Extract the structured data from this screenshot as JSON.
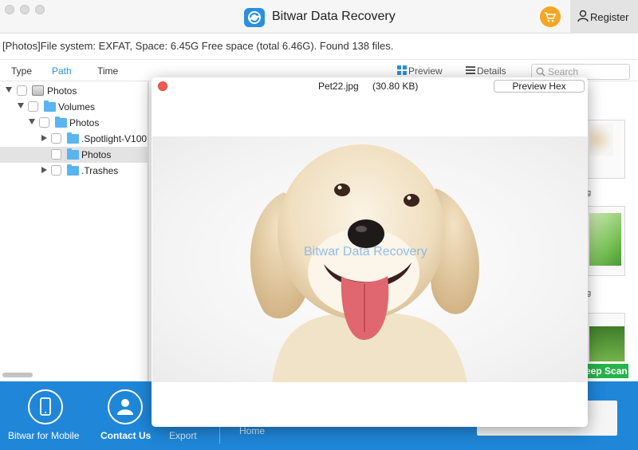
{
  "app": {
    "title": "Bitwar Data Recovery",
    "register_label": "Register"
  },
  "info": {
    "text": "[Photos]File system: EXFAT, Space: 6.45G Free space (total 6.46G). Found 138 files."
  },
  "toolbar": {
    "tabs": [
      {
        "label": "Type",
        "active": false
      },
      {
        "label": "Path",
        "active": true
      },
      {
        "label": "Time",
        "active": false
      }
    ],
    "preview_label": "Preview",
    "details_label": "Details",
    "search_placeholder": "Search"
  },
  "tree": {
    "items": [
      {
        "label": "Photos",
        "level": 0,
        "expander": "down",
        "icon": "drive-icon",
        "selected": false
      },
      {
        "label": "Volumes",
        "level": 1,
        "expander": "down",
        "icon": "folder-icon",
        "selected": false
      },
      {
        "label": "Photos",
        "level": 2,
        "expander": "down",
        "icon": "folder-icon",
        "selected": false
      },
      {
        "label": ".Spotlight-V100",
        "level": 3,
        "expander": "right",
        "icon": "folder-icon",
        "selected": false
      },
      {
        "label": "Photos",
        "level": 3,
        "expander": "none",
        "icon": "folder-icon",
        "selected": true
      },
      {
        "label": ".Trashes",
        "level": 3,
        "expander": "right",
        "icon": "folder-icon",
        "selected": false
      }
    ]
  },
  "files": {
    "captions": [
      "g",
      "g"
    ],
    "deep_scan_label": "eep Scan"
  },
  "preview": {
    "filename": "Pet22.jpg",
    "size": "(30.80 KB)",
    "hex_button_label": "Preview Hex",
    "watermark": "Bitwar Data Recovery"
  },
  "bottom": {
    "mobile_label": "Bitwar for Mobile",
    "contact_label": "Contact Us",
    "export_label": "Export",
    "home_label": "Home"
  },
  "colors": {
    "accent": "#2a8fe0",
    "bottom_bar": "#1f86d8",
    "deep_scan": "#27b34a",
    "cart": "#f5a623",
    "close": "#f05a4f"
  }
}
